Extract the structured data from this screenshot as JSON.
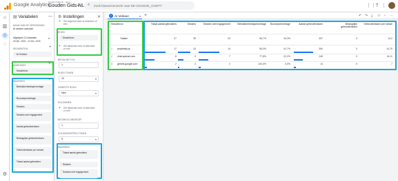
{
  "header": {
    "app_name": "Google Analytics",
    "account_sub": "Gouden Gids NL - Gouc...",
    "account_main": "Gouden Gids NL - GA4",
    "search_placeholder": "Zoek klassementvele naar DE-GGGE3E_GOEPT",
    "icons": [
      "apps-icon",
      "help-icon",
      "more-vert-icon"
    ]
  },
  "variables_panel": {
    "title": "Variabelen",
    "exploration_label": "NAAM VAN DE VERKENNING",
    "exploration_name": "AI verkeer overzicht",
    "dates_label": "Afgelopen 12 maanden",
    "dates_value": "25 feb. 2024 - 24 feb. 2025",
    "segments_label": "SEGMENTEN",
    "segments": [
      "AI Verkeer"
    ],
    "dimensions_label": "DIMENSIES",
    "dimensions": [
      "Sessiebron"
    ],
    "metrics_label": "WAARDEN",
    "metrics": [
      "Betrokkenheidspercentage",
      "Bouncepercentage",
      "Sessies",
      "Sessies met engagement",
      "Aantal gebeurtenissen",
      "Belangrijke gebeurtenissen",
      "Gebeurtenissen per sessie",
      "Totaal aantal gebruikers"
    ]
  },
  "instellingen_panel": {
    "title": "Instellingen",
    "segment_drop": "Zet segment neer of selecteer er een",
    "rows_label": "RIJEN",
    "rows_chip": "Sessiebron",
    "rows_drop": "Zet dimensie neer of selecteer er een",
    "start_row_label": "BEGIN MET RIJ",
    "start_row_value": "1",
    "show_rows_label": "RIJEN TONEN",
    "show_rows_value": "10",
    "nested_rows_label": "GENESTE RIJEN",
    "nested_rows_value": "Nee",
    "columns_label": "KOLOMMEN",
    "columns_drop": "Zet dimensie neer of selecteer er een",
    "start_col_label": "BEGINKOLOMGROEP",
    "start_col_value": "1",
    "show_cols_label": "KOLOMGROEPEN TONEN",
    "show_cols_value": "5",
    "values_label": "WAARDEN",
    "values": [
      "Totaal aantal gebruikers",
      "Sessies",
      "Sessies met engagement"
    ]
  },
  "report": {
    "tab_label": "AI Verkeer",
    "tab_add": "+",
    "dimension_header": "Sessiebron",
    "totals_label": "Totalen",
    "columns": [
      "Totaal aantal gebruikers",
      "Sessies",
      "Sessies met engagement",
      "Betrokkenheidspercentage",
      "Bouncepercentage",
      "Aantal gebeurtenissen",
      "Belangrijke gebeurtenissen",
      "Gebeurtenissen per sessie"
    ],
    "totals": [
      "27",
      "35",
      "23",
      "65,7%",
      "34,3%",
      "497",
      "0",
      "14,2"
    ],
    "rows": [
      {
        "idx": "1",
        "source": "perplexity.ai",
        "values": [
          "17",
          "24",
          "14",
          "58,3%",
          "41,7%",
          "354",
          "0",
          "14,75"
        ],
        "bar": 0.63
      },
      {
        "idx": "2",
        "source": "chat.openai.com",
        "values": [
          "8",
          "9",
          "7",
          "77,8%",
          "22,2%",
          "145",
          "0",
          "16,11"
        ],
        "bar": 0.3
      },
      {
        "idx": "3",
        "source": "gemini.google.com",
        "values": [
          "2",
          "2",
          "2",
          "100,0%",
          "0,0%",
          "14",
          "0",
          "7"
        ],
        "bar": 0.07
      }
    ]
  },
  "highlight_colors": {
    "green": "#2ecc40",
    "blue": "#1ba4e0"
  }
}
